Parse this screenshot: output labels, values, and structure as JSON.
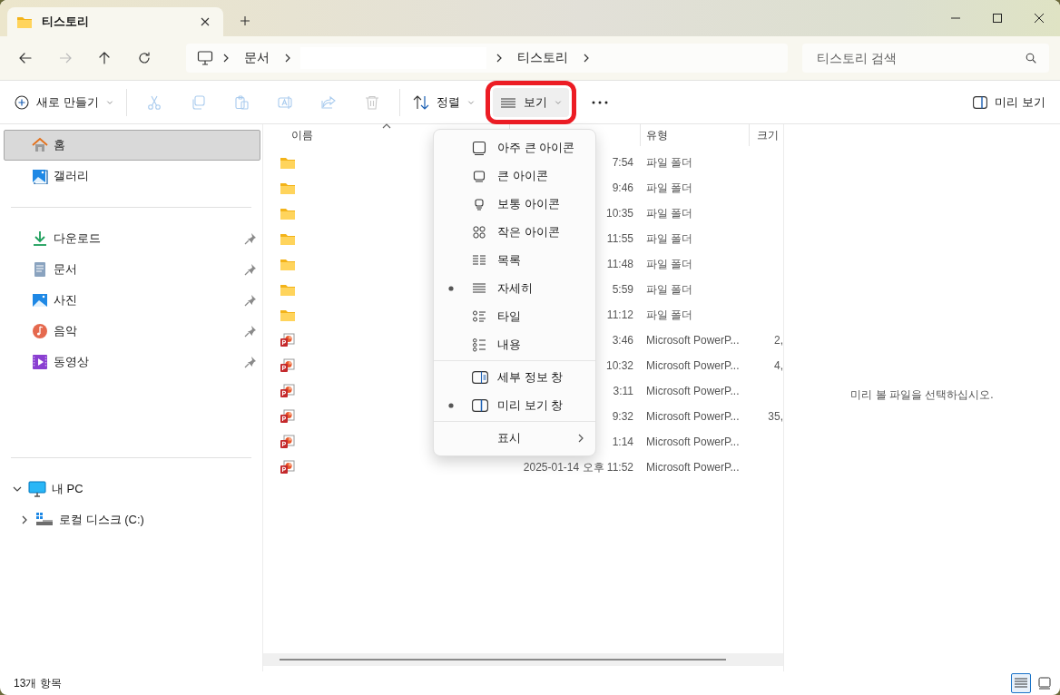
{
  "window": {
    "tab_title": "티스토리"
  },
  "address_bar": {
    "segments": [
      {
        "kind": "folder",
        "label": "문서"
      },
      {
        "kind": "blank"
      },
      {
        "kind": "folder",
        "label": "티스토리"
      }
    ],
    "search": {
      "placeholder": "티스토리 검색"
    }
  },
  "command_bar": {
    "new_button": {
      "label": "새로 만들기"
    },
    "actions": [
      {
        "disabled": true
      },
      {
        "disabled": true
      },
      {
        "disabled": true
      },
      {
        "disabled": true
      },
      {
        "disabled": true
      },
      {
        "disabled": true
      }
    ],
    "sort_button": {
      "label": "정렬",
      "highlighted": false
    },
    "view_button": {
      "label": "보기",
      "highlighted": true
    },
    "preview_button": {
      "label": "미리 보기"
    }
  },
  "sidebar": {
    "quick": [
      {
        "label": "홈",
        "selected": true,
        "pinned": false
      },
      {
        "label": "갤러리",
        "selected": false,
        "pinned": false
      }
    ],
    "pinned": [
      {
        "label": "다운로드",
        "selected": false,
        "pinned": true
      },
      {
        "label": "문서",
        "selected": false,
        "pinned": true
      },
      {
        "label": "사진",
        "selected": false,
        "pinned": true
      },
      {
        "label": "음악",
        "selected": false,
        "pinned": true
      },
      {
        "label": "동영상",
        "selected": false,
        "pinned": true
      }
    ],
    "tree": [
      {
        "label": "내 PC",
        "expanded": true,
        "children": [
          {
            "label": "로컬 디스크 (C:)",
            "expanded": false
          }
        ]
      }
    ]
  },
  "file_list": {
    "columns": [
      {
        "label": "이름",
        "sorted": true
      },
      {
        "label": "유형",
        "sorted": false
      },
      {
        "label": "크기",
        "sorted": false
      }
    ],
    "rows": [
      {
        "kind": "folder",
        "date": "7:54",
        "type": "파일 폴더"
      },
      {
        "kind": "folder",
        "date": "9:46",
        "type": "파일 폴더"
      },
      {
        "kind": "folder",
        "date": "10:35",
        "type": "파일 폴더"
      },
      {
        "kind": "folder",
        "date": "11:55",
        "type": "파일 폴더"
      },
      {
        "kind": "folder",
        "date": "11:48",
        "type": "파일 폴더"
      },
      {
        "kind": "folder",
        "date": "5:59",
        "type": "파일 폴더"
      },
      {
        "kind": "folder",
        "date": "11:12",
        "type": "파일 폴더"
      },
      {
        "kind": "presentation",
        "date": "3:46",
        "type": "Microsoft PowerP...",
        "size": "2,"
      },
      {
        "kind": "presentation",
        "date": "10:32",
        "type": "Microsoft PowerP...",
        "size": "4,"
      },
      {
        "kind": "presentation",
        "date": "3:11",
        "type": "Microsoft PowerP..."
      },
      {
        "kind": "presentation",
        "date": "9:32",
        "type": "Microsoft PowerP...",
        "size": "35,"
      },
      {
        "kind": "presentation",
        "date": "1:14",
        "type": "Microsoft PowerP..."
      },
      {
        "kind": "presentation",
        "date": "2025-01-14 오후 11:52",
        "type": "Microsoft PowerP..."
      }
    ]
  },
  "view_menu": {
    "groups": [
      [
        {
          "label": "아주 큰 아이콘",
          "selected": false,
          "has_submenu": false
        },
        {
          "label": "큰 아이콘",
          "selected": false,
          "has_submenu": false
        },
        {
          "label": "보통 아이콘",
          "selected": false,
          "has_submenu": false
        },
        {
          "label": "작은 아이콘",
          "selected": false,
          "has_submenu": false
        },
        {
          "label": "목록",
          "selected": false,
          "has_submenu": false
        },
        {
          "label": "자세히",
          "selected": true,
          "has_submenu": false
        },
        {
          "label": "타일",
          "selected": false,
          "has_submenu": false
        },
        {
          "label": "내용",
          "selected": false,
          "has_submenu": false
        }
      ],
      [
        {
          "label": "세부 정보 창",
          "selected": false,
          "has_submenu": false
        },
        {
          "label": "미리 보기 창",
          "selected": true,
          "has_submenu": false
        }
      ],
      [
        {
          "label": "표시",
          "selected": false,
          "has_submenu": true
        }
      ]
    ]
  },
  "preview_pane": {
    "message": "미리 볼 파일을 선택하십시오."
  },
  "status_bar": {
    "item_count": "13개 항목",
    "view_toggles": [
      {
        "selected": true
      },
      {
        "selected": false
      }
    ]
  }
}
